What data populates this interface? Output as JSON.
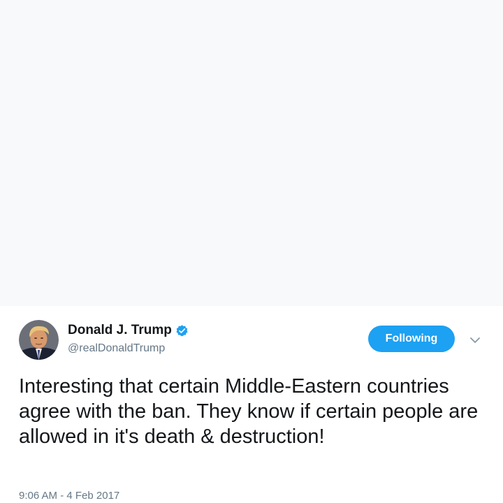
{
  "tweet": {
    "display_name": "Donald J. Trump",
    "handle": "@realDonaldTrump",
    "follow_button_label": "Following",
    "text": "Interesting that certain Middle-Eastern countries agree with the ban. They know if certain people are allowed in it's death & destruction!",
    "timestamp": "9:06 AM - 4 Feb 2017",
    "avatar_icon": "profile-photo",
    "verified_icon": "verified-badge-icon",
    "caret_icon": "chevron-down-icon"
  },
  "colors": {
    "accent": "#1da1f2",
    "text_primary": "#14171a",
    "text_secondary": "#657786",
    "top_background": "#f8f9fa"
  }
}
